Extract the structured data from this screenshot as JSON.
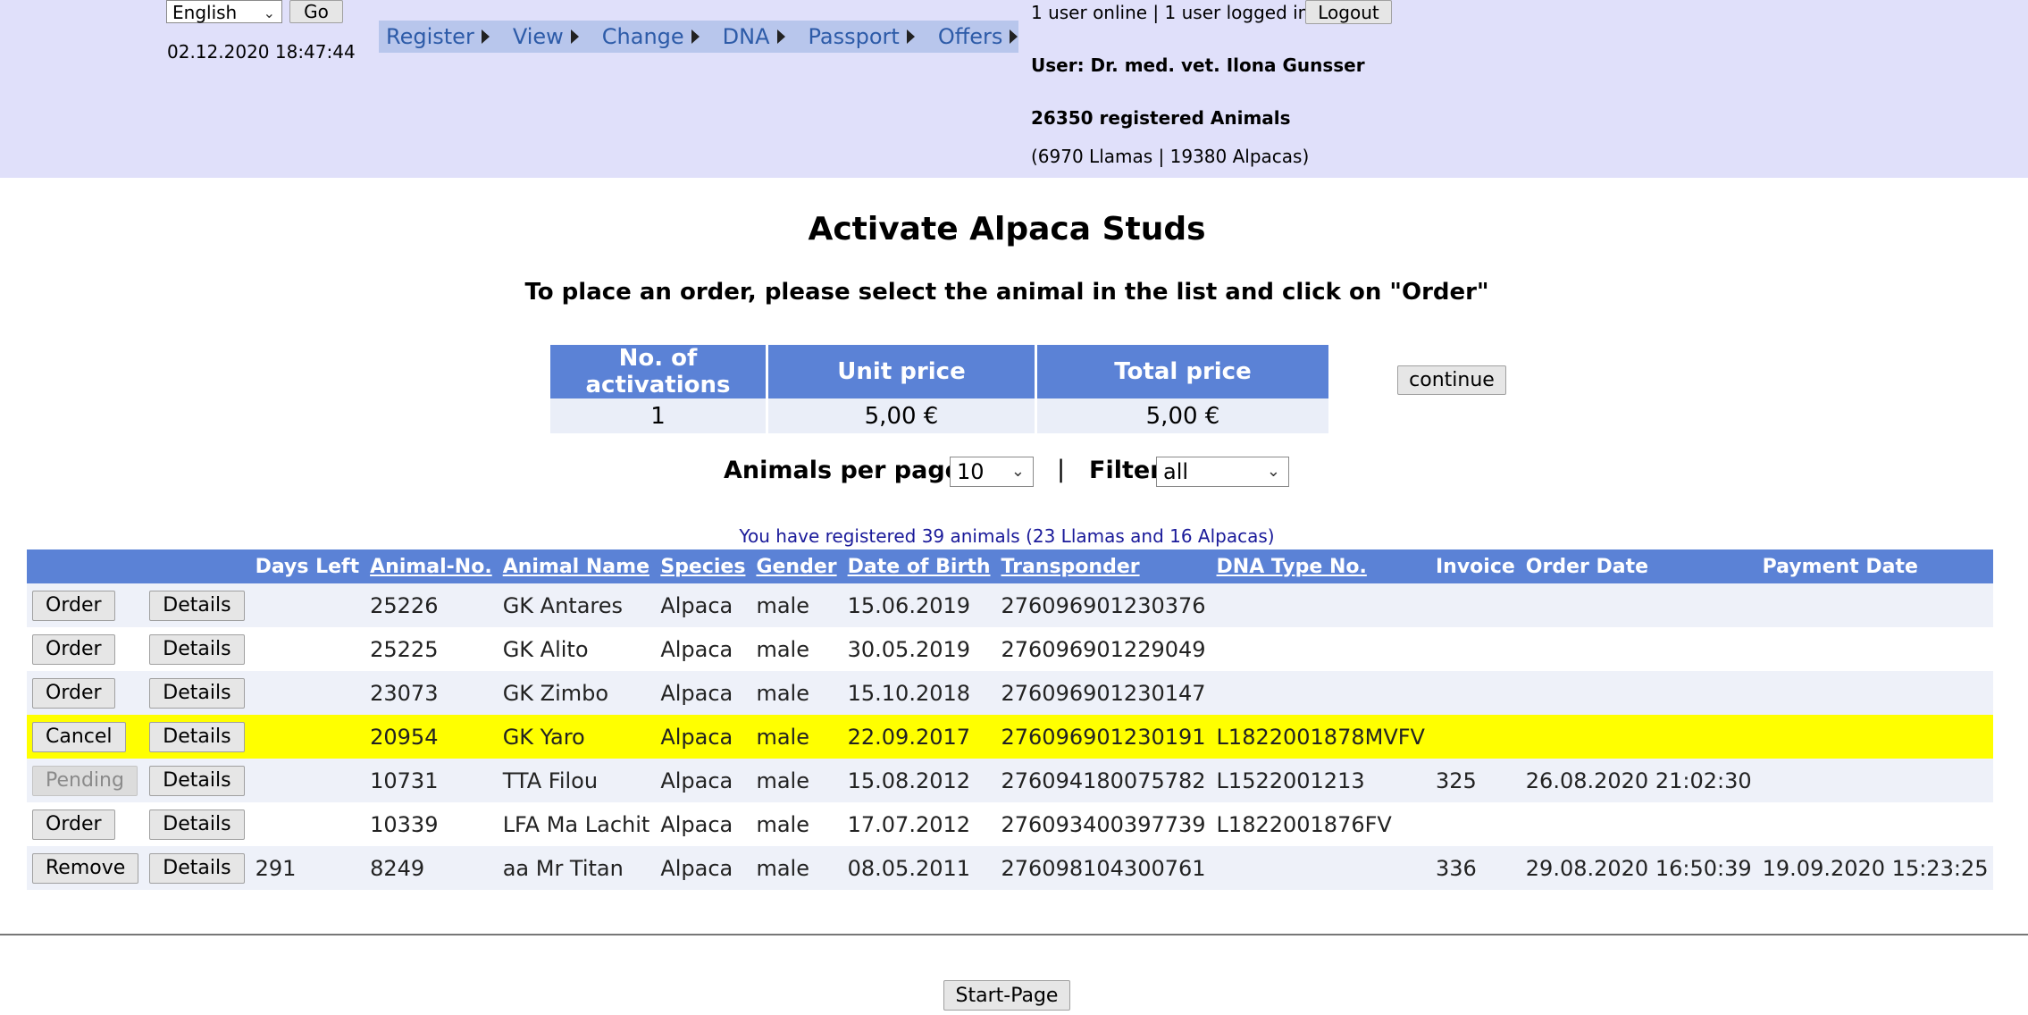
{
  "header": {
    "language": "English",
    "go_label": "Go",
    "datetime": "02.12.2020 18:47:44",
    "menu": [
      "Register",
      "View",
      "Change",
      "DNA",
      "Passport",
      "Offers"
    ],
    "online_status": "1 user online | 1 user logged in",
    "logout_label": "Logout",
    "user_line": "User: Dr. med. vet. Ilona Gunsser",
    "registered_animals": "26350 registered Animals",
    "species_breakdown": "(6970 Llamas | 19380 Alpacas)"
  },
  "main": {
    "title": "Activate Alpaca Studs",
    "instruction": "To place an order, please select the animal in the list and click on \"Order\"",
    "price_table": {
      "headers": [
        "No. of activations",
        "Unit price",
        "Total price"
      ],
      "values": [
        "1",
        "5,00 €",
        "5,00 €"
      ]
    },
    "continue_label": "continue",
    "per_page_label": "Animals per page:",
    "per_page_value": "10",
    "separator": "|",
    "filter_label": "Filter",
    "filter_value": "all",
    "registered_info": "You have registered 39 animals (23 Llamas and 16 Alpacas)",
    "table_headers": [
      "",
      "",
      "Days Left",
      "Animal-No.",
      "Animal Name",
      "Species",
      "Gender",
      "Date of Birth",
      "Transponder",
      "DNA Type No.",
      "Invoice",
      "Order Date",
      "Payment Date"
    ],
    "rows": [
      {
        "action": "Order",
        "details": "Details",
        "days_left": "",
        "animal_no": "25226",
        "name": "GK Antares",
        "species": "Alpaca",
        "gender": "male",
        "dob": "15.06.2019",
        "transponder": "276096901230376",
        "dna": "",
        "invoice": "",
        "order_date": "",
        "payment_date": ""
      },
      {
        "action": "Order",
        "details": "Details",
        "days_left": "",
        "animal_no": "25225",
        "name": "GK Alito",
        "species": "Alpaca",
        "gender": "male",
        "dob": "30.05.2019",
        "transponder": "276096901229049",
        "dna": "",
        "invoice": "",
        "order_date": "",
        "payment_date": ""
      },
      {
        "action": "Order",
        "details": "Details",
        "days_left": "",
        "animal_no": "23073",
        "name": "GK Zimbo",
        "species": "Alpaca",
        "gender": "male",
        "dob": "15.10.2018",
        "transponder": "276096901230147",
        "dna": "",
        "invoice": "",
        "order_date": "",
        "payment_date": ""
      },
      {
        "action": "Cancel",
        "details": "Details",
        "days_left": "",
        "animal_no": "20954",
        "name": "GK Yaro",
        "species": "Alpaca",
        "gender": "male",
        "dob": "22.09.2017",
        "transponder": "276096901230191",
        "dna": "L1822001878MVFV",
        "invoice": "",
        "order_date": "",
        "payment_date": ""
      },
      {
        "action": "Pending",
        "details": "Details",
        "days_left": "",
        "animal_no": "10731",
        "name": "TTA Filou",
        "species": "Alpaca",
        "gender": "male",
        "dob": "15.08.2012",
        "transponder": "276094180075782",
        "dna": "L1522001213",
        "invoice": "325",
        "order_date": "26.08.2020 21:02:30",
        "payment_date": ""
      },
      {
        "action": "Order",
        "details": "Details",
        "days_left": "",
        "animal_no": "10339",
        "name": "LFA Ma Lachit",
        "species": "Alpaca",
        "gender": "male",
        "dob": "17.07.2012",
        "transponder": "276093400397739",
        "dna": "L1822001876FV",
        "invoice": "",
        "order_date": "",
        "payment_date": ""
      },
      {
        "action": "Remove",
        "details": "Details",
        "days_left": "291",
        "animal_no": "8249",
        "name": "aa Mr Titan",
        "species": "Alpaca",
        "gender": "male",
        "dob": "08.05.2011",
        "transponder": "276098104300761",
        "dna": "",
        "invoice": "336",
        "order_date": "29.08.2020 16:50:39",
        "payment_date": "19.09.2020 15:23:25"
      }
    ],
    "start_page_label": "Start-Page"
  },
  "colors": {
    "header_bg": "#e0e0fa",
    "menu_bg": "#b8c6ec",
    "menu_text": "#2d5ba8",
    "table_header_bg": "#5b82d6",
    "highlight_row": "#ffff00",
    "info_text": "#1a1a9a"
  }
}
